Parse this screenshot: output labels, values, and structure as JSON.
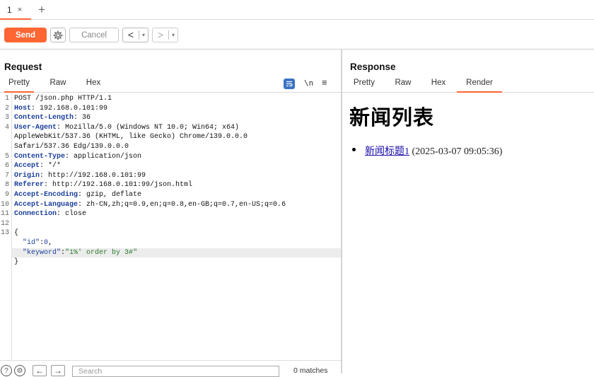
{
  "tabs": [
    {
      "label": "1",
      "close": "×"
    }
  ],
  "tab_add": "+",
  "toolbar": {
    "send_label": "Send",
    "cancel_label": "Cancel",
    "back_arrow": "<",
    "forward_arrow": ">",
    "dropdown": "▾"
  },
  "request": {
    "title": "Request",
    "tabs": [
      "Pretty",
      "Raw",
      "Hex"
    ],
    "active_tab": "Pretty",
    "newline_label": "\\n",
    "lines": [
      {
        "n": "1",
        "plain": "POST /json.php HTTP/1.1"
      },
      {
        "n": "2",
        "key": "Host",
        "val": ": 192.168.0.101:99"
      },
      {
        "n": "3",
        "key": "Content-Length",
        "val": ": 36"
      },
      {
        "n": "4",
        "key": "User-Agent",
        "val": ": Mozilla/5.0 (Windows NT 10.0; Win64; x64)"
      },
      {
        "n": "",
        "plain": "AppleWebKit/537.36 (KHTML, like Gecko) Chrome/139.0.0.0"
      },
      {
        "n": "",
        "plain": "Safari/537.36 Edg/139.0.0.0"
      },
      {
        "n": "5",
        "key": "Content-Type",
        "val": ": application/json"
      },
      {
        "n": "6",
        "key": "Accept",
        "val": ": */*"
      },
      {
        "n": "7",
        "key": "Origin",
        "val": ": http://192.168.0.101:99"
      },
      {
        "n": "8",
        "key": "Referer",
        "val": ": http://192.168.0.101:99/json.html"
      },
      {
        "n": "9",
        "key": "Accept-Encoding",
        "val": ": gzip, deflate"
      },
      {
        "n": "10",
        "key": "Accept-Language",
        "val": ": zh-CN,zh;q=0.9,en;q=0.8,en-GB;q=0.7,en-US;q=0.6"
      },
      {
        "n": "11",
        "key": "Connection",
        "val": ": close"
      },
      {
        "n": "12",
        "plain": ""
      },
      {
        "n": "13",
        "plain": "{"
      },
      {
        "n": "",
        "jkey": "\"id\"",
        "jsep": ":",
        "jval": "0",
        "jend": ","
      },
      {
        "n": "",
        "jkey": "\"keyword\"",
        "jsep": ":",
        "jstr": "\"1%' order by 3#\"",
        "highlight": true
      },
      {
        "n": "",
        "plain": "}"
      }
    ],
    "search_placeholder": "Search",
    "matches": "0 matches"
  },
  "response": {
    "title": "Response",
    "tabs": [
      "Pretty",
      "Raw",
      "Hex",
      "Render"
    ],
    "active_tab": "Render",
    "render": {
      "heading": "新闻列表",
      "items": [
        {
          "link": "新闻标题1",
          "date": " (2025-03-07 09:05:36)"
        }
      ]
    }
  },
  "colors": {
    "accent": "#ff6633",
    "header_key": "#1a3e9a",
    "json_string": "#2a7a2a",
    "link": "#1a0dab"
  }
}
